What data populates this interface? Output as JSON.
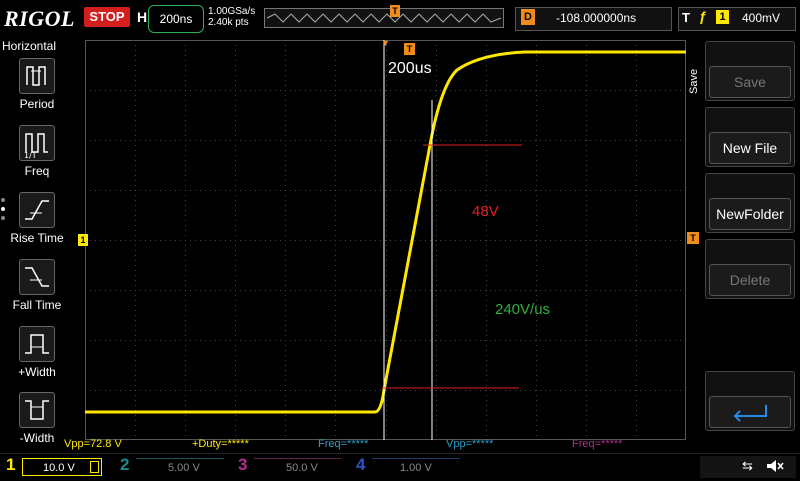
{
  "header": {
    "brand": "RIGOL",
    "run_state": "STOP",
    "horizontal_label": "H",
    "timebase": "200ns",
    "sample_rate": "1.00GSa/s",
    "memory_points": "2.40k pts",
    "memory_marker": "T",
    "delay_label": "D",
    "delay_value": "-108.000000ns",
    "trigger_label": "T",
    "trigger_edge": "ƒ",
    "trigger_channel": "1",
    "trigger_level": "400mV"
  },
  "left_menu": {
    "title": "Horizontal",
    "items": [
      {
        "label": "Period"
      },
      {
        "label": "Freq"
      },
      {
        "label": "Rise Time"
      },
      {
        "label": "Fall Time"
      },
      {
        "label": "+Width"
      },
      {
        "label": "-Width"
      }
    ]
  },
  "right_menu": {
    "title": "Save",
    "buttons": [
      {
        "label": "Save",
        "enabled": false
      },
      {
        "label": "New File",
        "enabled": true
      },
      {
        "label": "NewFolder",
        "enabled": true
      },
      {
        "label": "Delete",
        "enabled": false
      },
      {
        "label": "",
        "icon": "enter-icon"
      }
    ]
  },
  "display": {
    "ch1_marker": "1",
    "trigger_marker": "T",
    "trigger_top_marker": "T",
    "annotation_time": "200us",
    "annotation_voltage": "48V",
    "annotation_slew": "240V/us",
    "colors": {
      "trace": "#ffe800",
      "cursor": "#ffffff",
      "level_lines": "#e02020",
      "voltage_text": "#e02020",
      "slew_text": "#2fae3c",
      "grid": "#3a3a3a",
      "marker_orange": "#f08c1a"
    }
  },
  "measurements": {
    "vpp": "Vpp=72.8 V",
    "duty": "+Duty=*****",
    "freq1": "Freq=*****",
    "vpp2": "Vpp=*****",
    "freq2": "Freq=*****"
  },
  "channels": [
    {
      "num": "1",
      "scale": "10.0 V",
      "color": "#ffe800",
      "active": true
    },
    {
      "num": "2",
      "scale": "5.00 V",
      "color": "#1a8a8a",
      "active": false
    },
    {
      "num": "3",
      "scale": "50.0 V",
      "color": "#b0308f",
      "active": false
    },
    {
      "num": "4",
      "scale": "1.00 V",
      "color": "#2a55c8",
      "active": false
    }
  ],
  "status_icons": [
    "usb-icon",
    "speaker-muted-icon"
  ]
}
